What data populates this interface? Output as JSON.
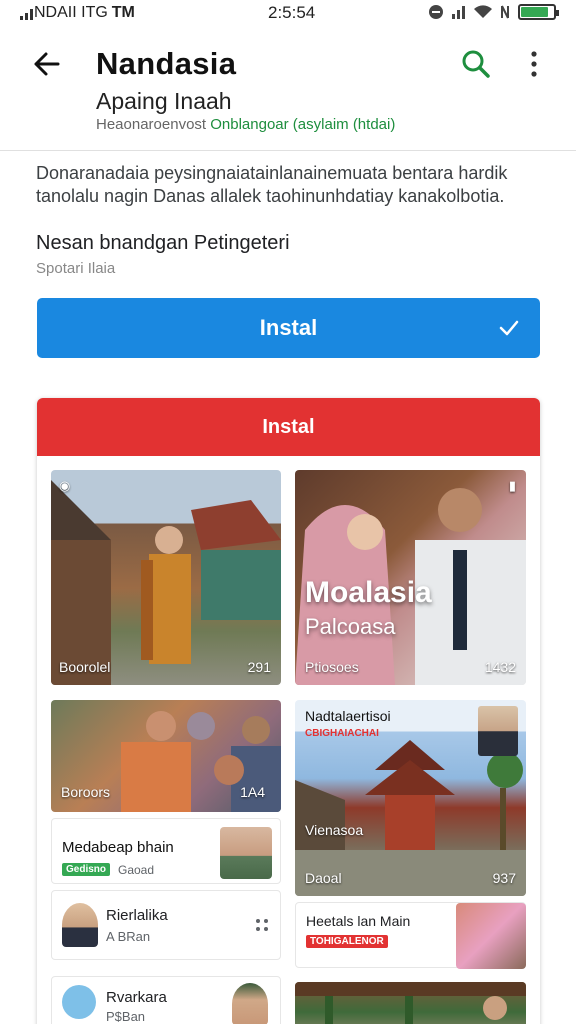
{
  "status_bar": {
    "carrier": "NDAII ITG",
    "carrier_mark": "TM",
    "time": "2:5:54"
  },
  "app_bar": {
    "title": "Nandasia",
    "back_icon": "arrow-left-icon",
    "search_icon": "search-icon",
    "more_icon": "more-vertical-icon"
  },
  "app_info": {
    "subtitle": "Apaing Inaah",
    "meta_gray": "Heaonaroenvost",
    "meta_green": "Onblangoar (asylaim (htdai)",
    "description": "Donaranadaia peysingnaiatainlanainemuata bentara hardik tanolalu nagin Danas allalek taohinunhdatiay kanakolbotia.",
    "info_title": "Nesan bnandgan Petingeteri",
    "info_sub": "Spotari Ilaia"
  },
  "install_button": {
    "label": "Instal",
    "icon": "check-icon"
  },
  "card": {
    "header": "Instal",
    "tiles": [
      {
        "caption": "Boorolel",
        "corner": "291"
      },
      {
        "title": "Moalasia",
        "subtitle": "Palcoasa",
        "caption": "Ptiosoes",
        "corner": "1432"
      },
      {
        "caption": "Boroors",
        "corner": "1A4"
      },
      {
        "heading": "Nadtalaertisoi",
        "subheading": "CBIGHAIACHAI",
        "caption1": "Vienasoa",
        "caption2": "Daoal",
        "corner": "937"
      },
      {}
    ],
    "items": [
      {
        "name": "Medabeap bhain",
        "tag": "Gedisno",
        "sub": "Gaoad"
      },
      {
        "name": "Rierlalika",
        "sub": "A BRan"
      },
      {
        "name": "Rvarkara",
        "sub": "P$Ban"
      },
      {
        "name": "Heetals lan Main",
        "tag": "TOHIGALENOR"
      }
    ]
  },
  "colors": {
    "primary_blue": "#1a88e0",
    "header_red": "#e23232",
    "accent_green": "#1e8e3e"
  }
}
